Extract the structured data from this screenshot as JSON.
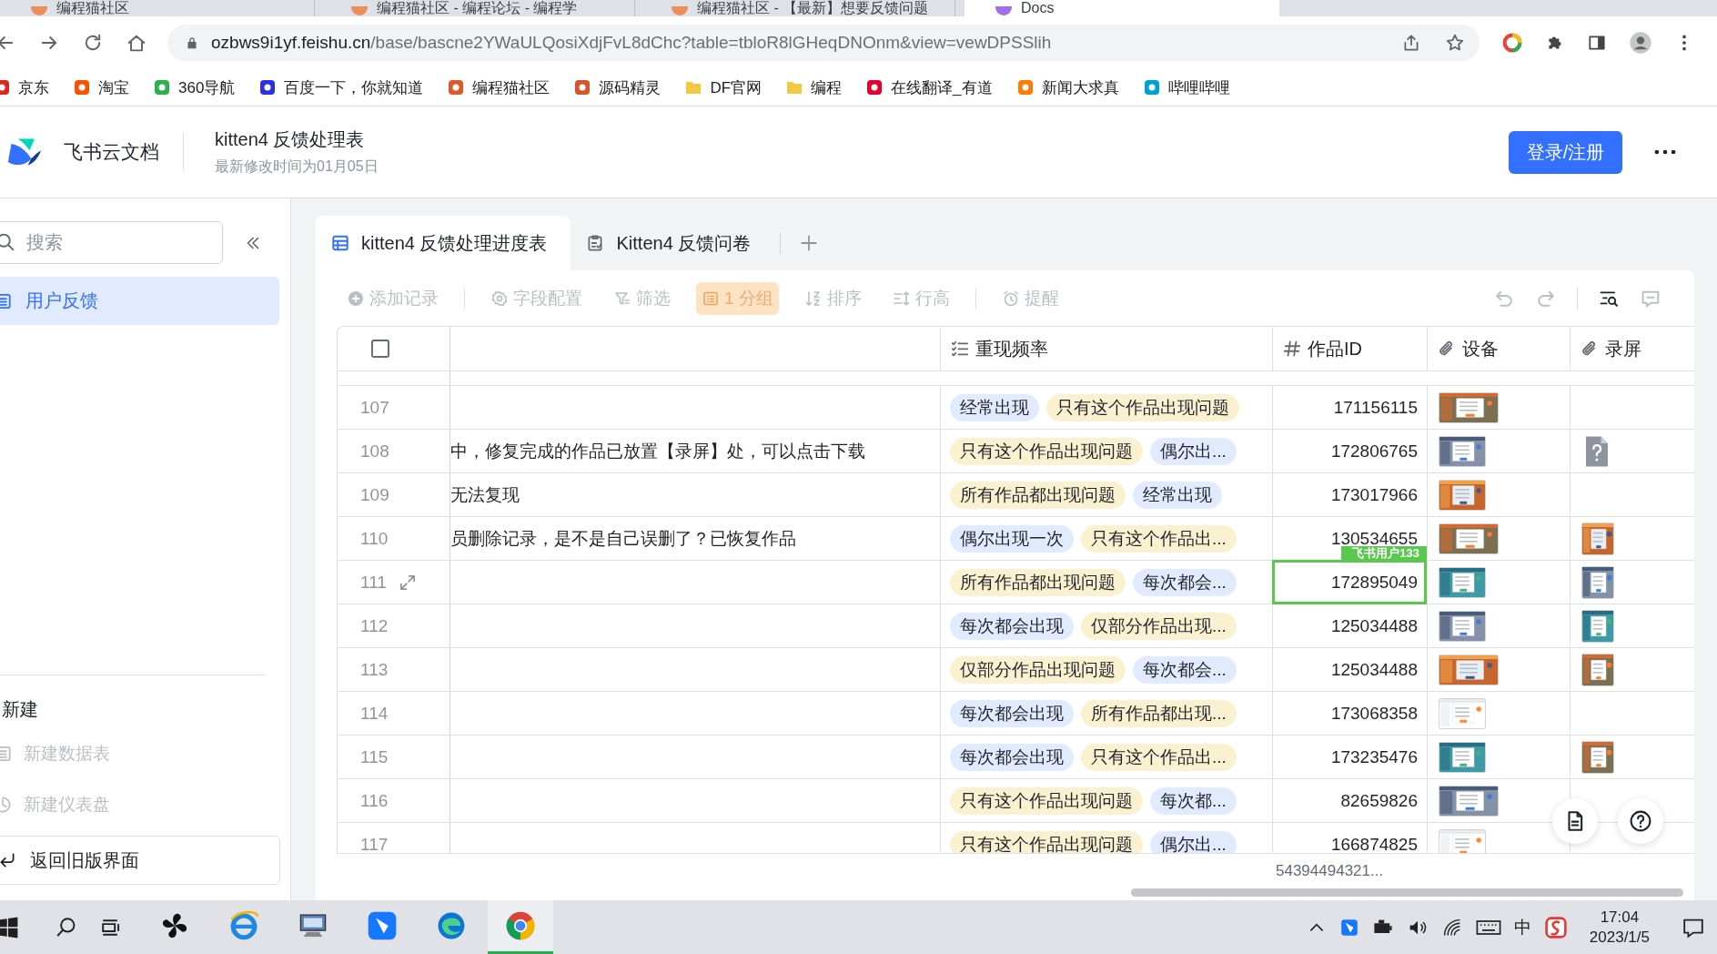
{
  "browser": {
    "tabs": [
      {
        "title": "编程猫社区",
        "selected": false
      },
      {
        "title": "编程猫社区 - 编程论坛 - 编程学",
        "selected": false
      },
      {
        "title": "编程猫社区 - 【最新】想要反馈问题",
        "selected": false
      },
      {
        "title": "Docs",
        "selected": true
      }
    ],
    "url": {
      "domain": "ozbws9i1yf.feishu.cn",
      "path": "/base/bascne2YWaULQosiXdjFvL8dChc?table=tbloR8lGHeqDNOnm&view=vewDPSSlih"
    },
    "bookmarks": [
      {
        "label": "京东",
        "kind": "site",
        "color": "#e1251b"
      },
      {
        "label": "淘宝",
        "kind": "site",
        "color": "#ff5000"
      },
      {
        "label": "360导航",
        "kind": "site",
        "color": "#2bb24c"
      },
      {
        "label": "百度一下，你就知道",
        "kind": "site",
        "color": "#2932e1"
      },
      {
        "label": "编程猫社区",
        "kind": "site",
        "color": "#e0582a"
      },
      {
        "label": "源码精灵",
        "kind": "site",
        "color": "#d9542b"
      },
      {
        "label": "DF官网",
        "kind": "folder",
        "color": "#f4c842"
      },
      {
        "label": "编程",
        "kind": "folder",
        "color": "#f4c842"
      },
      {
        "label": "在线翻译_有道",
        "kind": "site",
        "color": "#e4002b"
      },
      {
        "label": "新闻大求真",
        "kind": "site",
        "color": "#ff7b00"
      },
      {
        "label": "哔哩哔哩",
        "kind": "site",
        "color": "#00a1d6"
      }
    ]
  },
  "app_header": {
    "brand": "飞书云文档",
    "doc_title": "kitten4 反馈处理表",
    "modified": "最新修改时间为01月05日",
    "login_button": "登录/注册"
  },
  "sidebar": {
    "search": {
      "placeholder": "搜索"
    },
    "items": [
      {
        "label": "用户反馈",
        "selected": true
      }
    ],
    "section_title": "新建",
    "create_items": [
      {
        "label": "新建数据表",
        "kind": "table",
        "disabled": true
      },
      {
        "label": "新建仪表盘",
        "kind": "dashboard",
        "disabled": true
      }
    ],
    "back_button": "返回旧版界面"
  },
  "sheet_tabs": [
    {
      "label": "kitten4 反馈处理进度表",
      "kind": "table",
      "selected": true
    },
    {
      "label": "Kitten4 反馈问卷",
      "kind": "form",
      "selected": false
    }
  ],
  "toolbar": [
    {
      "label": "添加记录",
      "kind": "add",
      "disabled": true,
      "selected": false
    },
    {
      "label": "字段配置",
      "kind": "fields",
      "disabled": true,
      "selected": false
    },
    {
      "label": "筛选",
      "kind": "filter",
      "disabled": true,
      "selected": false
    },
    {
      "label": "1 分组",
      "kind": "group",
      "disabled": true,
      "selected": true
    },
    {
      "label": "排序",
      "kind": "sort",
      "disabled": true,
      "selected": false
    },
    {
      "label": "行高",
      "kind": "row-height",
      "disabled": true,
      "selected": false
    },
    {
      "label": "提醒",
      "kind": "reminder",
      "disabled": true,
      "selected": false
    }
  ],
  "table": {
    "header_checked": false,
    "columns": [
      {
        "label": "重现频率",
        "kind": "multi-select"
      },
      {
        "label": "作品ID",
        "kind": "number"
      },
      {
        "label": "设备",
        "kind": "attachment"
      },
      {
        "label": "录屏",
        "kind": "attachment"
      }
    ],
    "rows": [
      {
        "number": "107",
        "hovered": false,
        "tags": [
          {
            "label": "经常出现",
            "color": "#e1eaff"
          },
          {
            "label": "只有这个作品出现问题",
            "color": "#faf1d1"
          }
        ],
        "id": "171156115",
        "active": false,
        "device": [
          {
            "kind": "picture"
          }
        ]
      },
      {
        "number": "108",
        "hovered": false,
        "text": "中，修复完成的作品已放置【录屏】处，可以点击下载",
        "tags": [
          {
            "label": "只有这个作品出现问题",
            "color": "#faf1d1"
          },
          {
            "label": "偶尔出...",
            "color": "#e1eaff"
          }
        ],
        "id": "172806765",
        "active": false,
        "device": [
          {
            "kind": "picture"
          }
        ],
        "recording": [
          {
            "kind": "unknown-file"
          }
        ]
      },
      {
        "number": "109",
        "hovered": false,
        "text": "无法复现",
        "tags": [
          {
            "label": "所有作品都出现问题",
            "color": "#faf1d1"
          },
          {
            "label": "经常出现",
            "color": "#e1eaff"
          }
        ],
        "id": "173017966",
        "active": false,
        "device": [
          {
            "kind": "picture"
          }
        ]
      },
      {
        "number": "110",
        "hovered": false,
        "text": "员删除记录，是不是自己误删了？已恢复作品",
        "tags": [
          {
            "label": "偶尔出现一次",
            "color": "#e1eaff"
          },
          {
            "label": "只有这个作品出...",
            "color": "#faf1d1"
          }
        ],
        "id": "130534655",
        "active": false,
        "device": [
          {
            "kind": "picture"
          }
        ],
        "recording": [
          {
            "kind": "picture"
          }
        ]
      },
      {
        "number": "111",
        "hovered": true,
        "tags": [
          {
            "label": "所有作品都出现问题",
            "color": "#faf1d1"
          },
          {
            "label": "每次都会...",
            "color": "#e1eaff"
          }
        ],
        "id": "172895049",
        "active": true,
        "active_user": "飞书用户133",
        "device": [
          {
            "kind": "picture"
          }
        ],
        "recording": [
          {
            "kind": "picture"
          }
        ]
      },
      {
        "number": "112",
        "hovered": false,
        "tags": [
          {
            "label": "每次都会出现",
            "color": "#e1eaff"
          },
          {
            "label": "仅部分作品出现...",
            "color": "#faf1d1"
          }
        ],
        "id": "125034488",
        "active": false,
        "device": [
          {
            "kind": "picture"
          }
        ],
        "recording": [
          {
            "kind": "picture"
          }
        ]
      },
      {
        "number": "113",
        "hovered": false,
        "tags": [
          {
            "label": "仅部分作品出现问题",
            "color": "#faf1d1"
          },
          {
            "label": "每次都会...",
            "color": "#e1eaff"
          }
        ],
        "id": "125034488",
        "active": false,
        "device": [
          {
            "kind": "picture"
          }
        ],
        "recording": [
          {
            "kind": "picture"
          }
        ]
      },
      {
        "number": "114",
        "hovered": false,
        "tags": [
          {
            "label": "每次都会出现",
            "color": "#e1eaff"
          },
          {
            "label": "所有作品都出现...",
            "color": "#faf1d1"
          }
        ],
        "id": "173068358",
        "active": false,
        "device": [
          {
            "kind": "picture"
          }
        ]
      },
      {
        "number": "115",
        "hovered": false,
        "tags": [
          {
            "label": "每次都会出现",
            "color": "#e1eaff"
          },
          {
            "label": "只有这个作品出...",
            "color": "#faf1d1"
          }
        ],
        "id": "173235476",
        "active": false,
        "device": [
          {
            "kind": "picture"
          }
        ],
        "recording": [
          {
            "kind": "picture"
          }
        ]
      },
      {
        "number": "116",
        "hovered": false,
        "tags": [
          {
            "label": "只有这个作品出现问题",
            "color": "#faf1d1"
          },
          {
            "label": "每次都...",
            "color": "#e1eaff"
          }
        ],
        "id": "82659826",
        "active": false,
        "device": [
          {
            "kind": "picture"
          }
        ]
      },
      {
        "number": "117",
        "hovered": false,
        "tags": [
          {
            "label": "只有这个作品出现问题",
            "color": "#faf1d1"
          },
          {
            "label": "偶尔出...",
            "color": "#e1eaff"
          }
        ],
        "id": "166874825",
        "active": false,
        "device": [
          {
            "kind": "picture"
          }
        ]
      }
    ],
    "summary": "54394494321..."
  },
  "taskbar": {
    "apps": [
      {
        "kind": "pinwheel",
        "selected": false
      },
      {
        "kind": "ie",
        "selected": false
      },
      {
        "kind": "computer",
        "selected": false
      },
      {
        "kind": "bird",
        "selected": false
      },
      {
        "kind": "edge",
        "selected": false
      },
      {
        "kind": "chrome",
        "selected": true
      }
    ],
    "ime": "中",
    "time": "17:04",
    "date": "2023/1/5"
  }
}
